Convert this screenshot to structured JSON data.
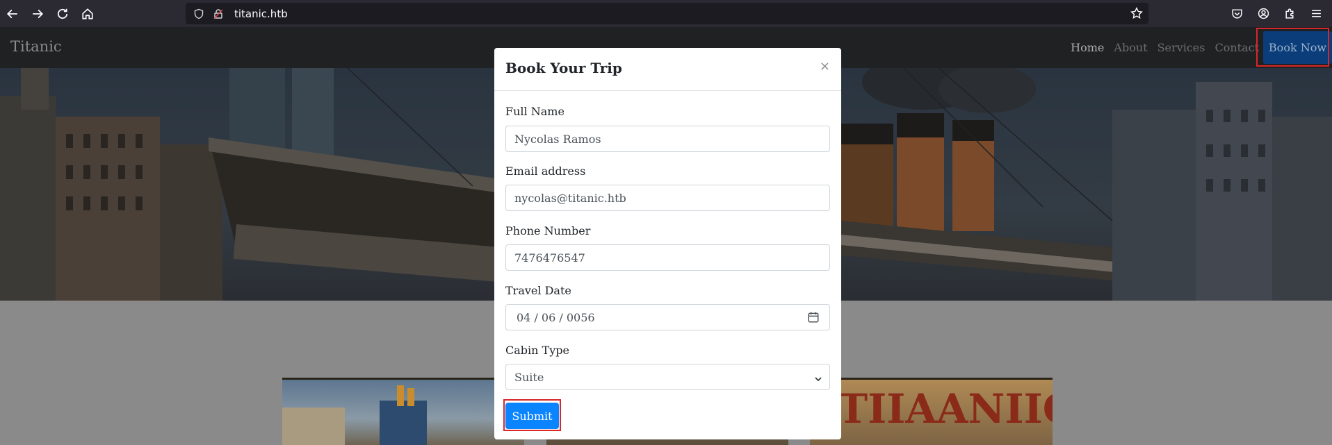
{
  "browser": {
    "url": "titanic.htb"
  },
  "site": {
    "brand": "Titanic",
    "nav": [
      {
        "label": "Home"
      },
      {
        "label": "About"
      },
      {
        "label": "Services"
      },
      {
        "label": "Contact"
      }
    ],
    "book_now_label": "Book Now"
  },
  "modal": {
    "title": "Book Your Trip",
    "close_glyph": "×",
    "fields": {
      "full_name": {
        "label": "Full Name",
        "value": "Nycolas Ramos"
      },
      "email": {
        "label": "Email address",
        "value": "nycolas@titanic.htb"
      },
      "phone": {
        "label": "Phone Number",
        "value": "7476476547"
      },
      "date": {
        "label": "Travel Date",
        "value": "04 / 06 / 0056"
      },
      "cabin": {
        "label": "Cabin Type",
        "value": "Suite"
      }
    },
    "submit_label": "Submit"
  },
  "colors": {
    "highlight": "#d9262b",
    "primary_button": "#0a84ff",
    "navbar": "#202122"
  },
  "icons": [
    "back-icon",
    "forward-icon",
    "reload-icon",
    "home-icon",
    "shield-icon",
    "lock-icon",
    "star-icon",
    "pocket-icon",
    "account-icon",
    "extensions-icon",
    "menu-icon",
    "calendar-icon",
    "chevron-down-icon",
    "close-icon"
  ]
}
